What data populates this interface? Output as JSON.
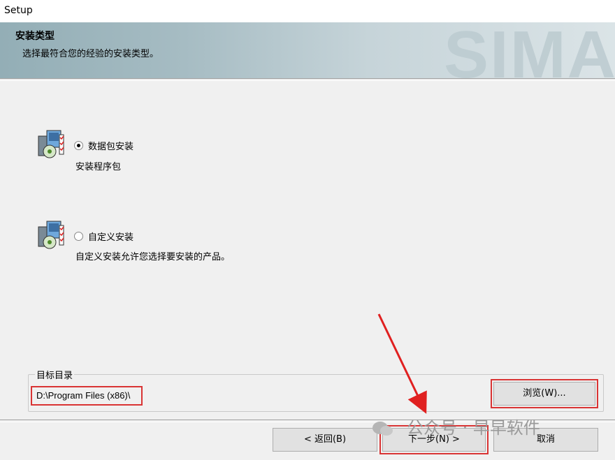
{
  "window": {
    "title": "Setup"
  },
  "header": {
    "title": "安装类型",
    "subtitle": "选择最符合您的经验的安装类型。",
    "watermark": "SIMA"
  },
  "options": [
    {
      "label": "数据包安装",
      "desc": "安装程序包",
      "selected": true
    },
    {
      "label": "自定义安装",
      "desc": "自定义安装允许您选择要安装的产品。",
      "selected": false
    }
  ],
  "target": {
    "group_label": "目标目录",
    "path": "D:\\Program Files (x86)\\",
    "browse_label": "浏览(W)..."
  },
  "buttons": {
    "back": "< 返回(B)",
    "next": "下一步(N) >",
    "cancel": "取消"
  },
  "watermark_text": "公众号 · 早早软件",
  "colors": {
    "highlight": "#d93434"
  }
}
